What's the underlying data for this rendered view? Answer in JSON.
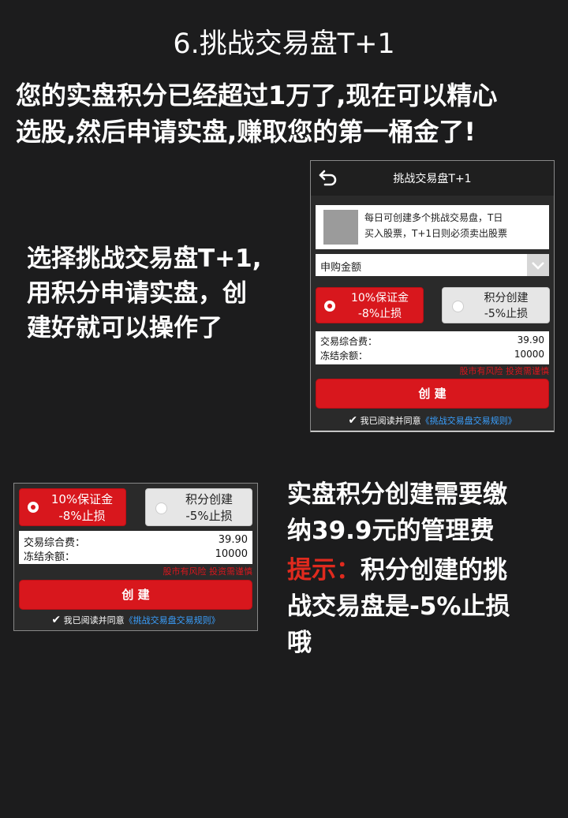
{
  "title": "6.挑战交易盘T+1",
  "intro": {
    "line1": "您的实盘积分已经超过1万了,现在可以精心",
    "line2": "选股,然后申请实盘,赚取您的第一桶金了!"
  },
  "desc1": {
    "line1": "选择挑战交易盘T+1,",
    "line2": "用积分申请实盘，创",
    "line3": "建好就可以操作了"
  },
  "desc2": {
    "line1": "实盘积分创建需要缴",
    "line2": "纳39.9元的管理费",
    "tip_label": "提示：",
    "tip_line1": "积分创建的挑",
    "tip_line2": "战交易盘是-5%止损",
    "tip_line3": "哦"
  },
  "app": {
    "header_title": "挑战交易盘T+1",
    "notice_line1": "每日可创建多个挑战交易盘，T日",
    "notice_line2": "买入股票，T+1日则必须卖出股票",
    "select_label": "申购金额",
    "option1_line1": "10%保证金",
    "option1_line2": "-8%止损",
    "option2_line1": "积分创建",
    "option2_line2": "-5%止损",
    "fee_label": "交易综合费：",
    "fee_value": "39.90",
    "frozen_label": "冻结余额：",
    "frozen_value": "10000",
    "risk_text": "股市有风险 投资需谨慎",
    "create_button": "创 建",
    "agree_prefix": "我已阅读并同意",
    "agree_link": "《挑战交易盘交易规则》"
  },
  "colors": {
    "background": "#1c1c1d",
    "accent_red": "#d8171d",
    "tip_red": "#e02a1e",
    "link_blue": "#3aa0ff"
  },
  "icons": [
    "back-arrow-icon",
    "chevron-down-icon",
    "radio-selected-icon",
    "radio-unselected-icon",
    "checkmark-icon"
  ]
}
